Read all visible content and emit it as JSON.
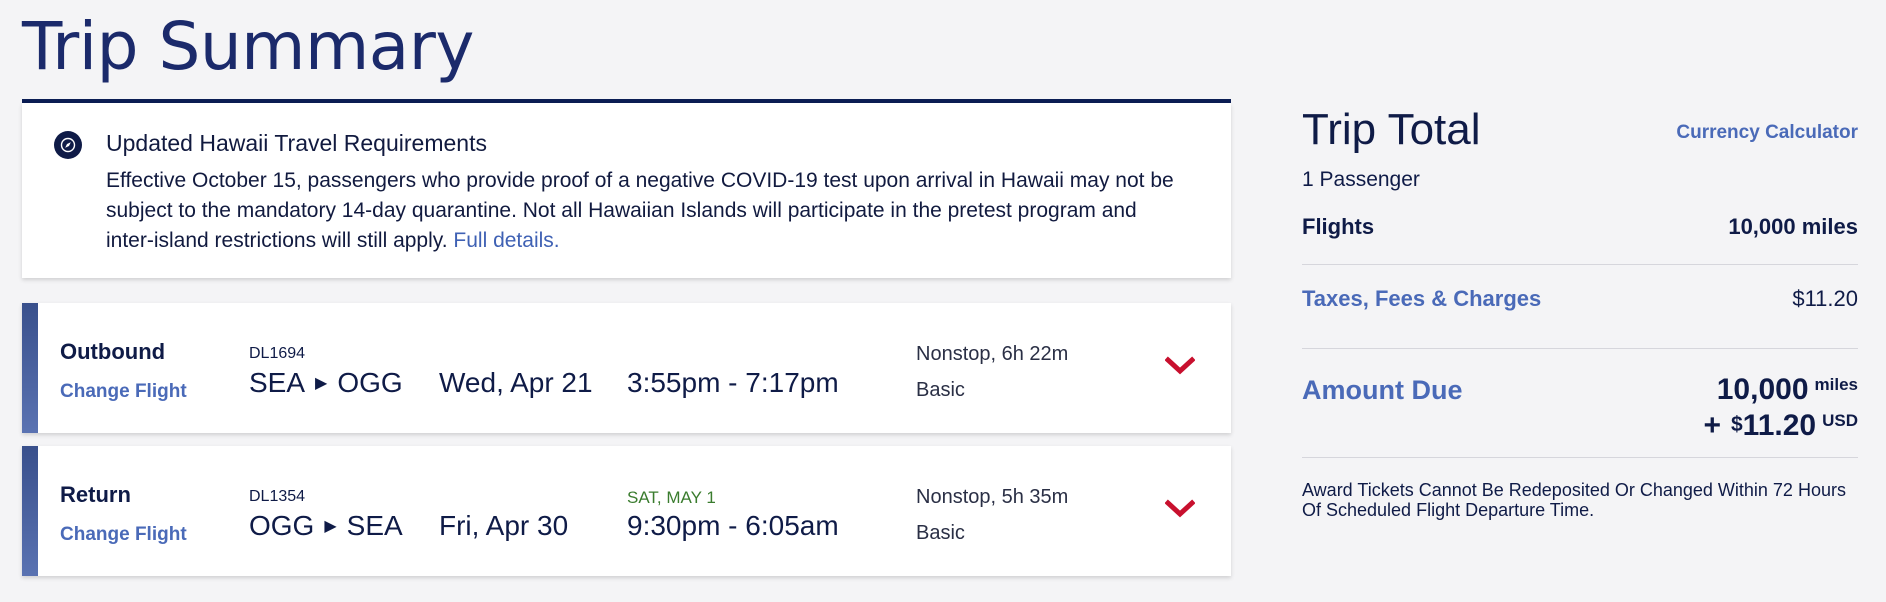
{
  "page": {
    "title": "Trip Summary"
  },
  "notice": {
    "title": "Updated Hawaii Travel Requirements",
    "body": "Effective October 15, passengers who provide proof of a negative COVID-19 test upon arrival in Hawaii may not be subject to the mandatory 14-day quarantine. Not all Hawaiian Islands will participate in the pretest program and inter-island restrictions will still apply.",
    "link_label": "Full details."
  },
  "flights": [
    {
      "leg": "Outbound",
      "change_label": "Change Flight",
      "flight_number": "DL1694",
      "origin": "SEA",
      "destination": "OGG",
      "date": "Wed, Apr 21",
      "next_day_label": "",
      "times": "3:55pm - 7:17pm",
      "duration": "Nonstop, 6h 22m",
      "cabin": "Basic"
    },
    {
      "leg": "Return",
      "change_label": "Change Flight",
      "flight_number": "DL1354",
      "origin": "OGG",
      "destination": "SEA",
      "date": "Fri, Apr 30",
      "next_day_label": "SAT, MAY 1",
      "times": "9:30pm - 6:05am",
      "duration": "Nonstop, 5h 35m",
      "cabin": "Basic"
    }
  ],
  "trip_total": {
    "title": "Trip Total",
    "currency_link": "Currency Calculator",
    "passengers": "1 Passenger",
    "flights_label": "Flights",
    "flights_value": "10,000 miles",
    "taxes_label": "Taxes, Fees & Charges",
    "taxes_value": "$11.20",
    "amount_due_label": "Amount Due",
    "amount_miles": "10,000",
    "amount_miles_unit": "miles",
    "amount_plus": "+",
    "amount_currency_symbol": "$",
    "amount_usd": "11.20",
    "amount_usd_unit": "USD",
    "award_note": "Award Tickets Cannot Be Redeposited Or Changed Within 72 Hours Of Scheduled Flight Departure Time."
  },
  "colors": {
    "navy": "#0f1b47",
    "link_blue": "#4a6ab8",
    "accent_red": "#c8102e",
    "next_day_green": "#3a7c2e"
  },
  "icons": {
    "notice": "compass-icon",
    "expand": "chevron-down-icon",
    "route": "triangle-right-icon"
  }
}
